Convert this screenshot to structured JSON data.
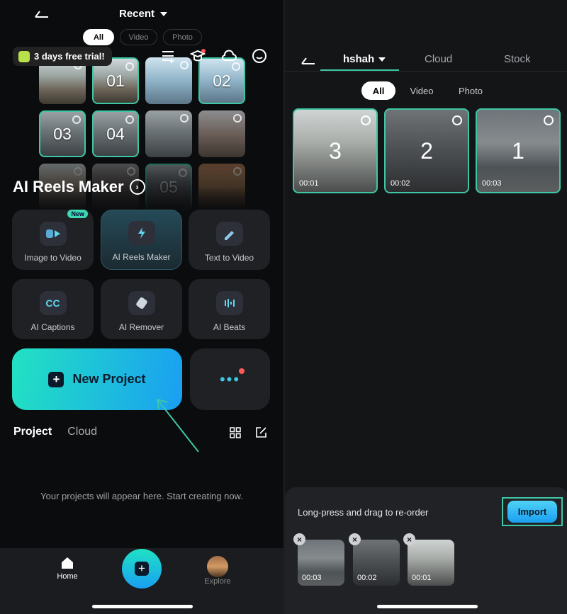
{
  "left": {
    "header": {
      "title": "Recent"
    },
    "filters": [
      "All",
      "Video",
      "Photo"
    ],
    "trial_label": "3 days free trial!",
    "thumbs": [
      "01",
      "02",
      "03",
      "04",
      "05"
    ],
    "section_title": "AI Reels Maker",
    "tools": [
      {
        "label": "Image to Video",
        "badge": "New"
      },
      {
        "label": "AI Reels Maker"
      },
      {
        "label": "Text  to Video"
      },
      {
        "label": "AI Captions"
      },
      {
        "label": "AI Remover"
      },
      {
        "label": "AI Beats"
      }
    ],
    "new_project_label": "New Project",
    "project_tabs": [
      "Project",
      "Cloud"
    ],
    "empty_message": "Your projects will appear here. Start creating now.",
    "nav": {
      "home": "Home",
      "explore": "Explore"
    }
  },
  "right": {
    "tabs": {
      "user": "hshah",
      "cloud": "Cloud",
      "stock": "Stock"
    },
    "filters": [
      "All",
      "Video",
      "Photo"
    ],
    "media": [
      {
        "number": "3",
        "duration": "00:01"
      },
      {
        "number": "2",
        "duration": "00:02"
      },
      {
        "number": "1",
        "duration": "00:03"
      }
    ],
    "hint": "Long-press and drag to re-order",
    "import_label": "Import",
    "selected": [
      {
        "duration": "00:03"
      },
      {
        "duration": "00:02"
      },
      {
        "duration": "00:01"
      }
    ],
    "remove_glyph": "×"
  },
  "colors": {
    "accent": "#3ec7a5",
    "gradient_start": "#22e2c2",
    "gradient_end": "#1a9ff2",
    "notify": "#ff5a5a"
  }
}
